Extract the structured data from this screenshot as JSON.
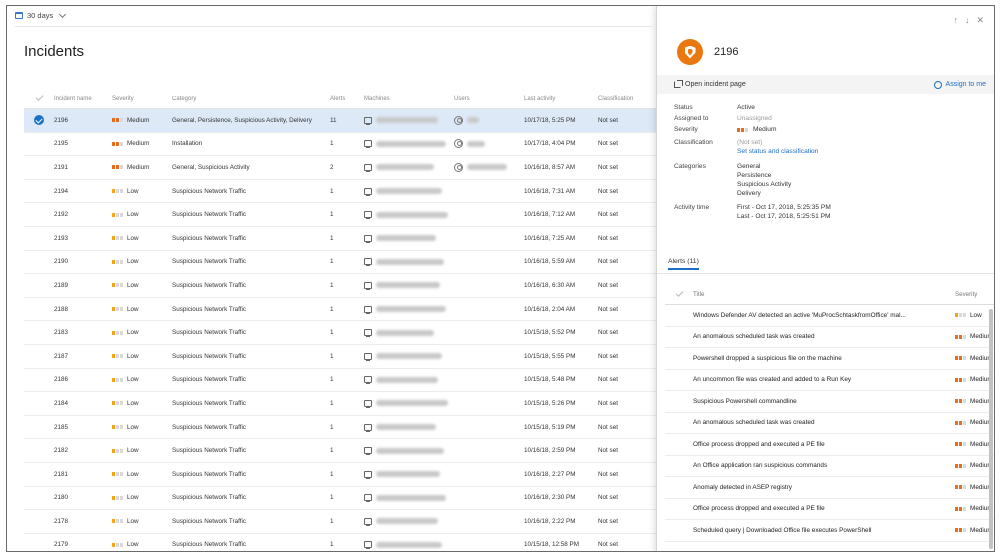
{
  "filter": {
    "label": "30 days"
  },
  "page": {
    "title": "Incidents"
  },
  "table": {
    "headers": [
      "Incident name",
      "Severity",
      "Category",
      "Alerts",
      "Machines",
      "Users",
      "Last activity",
      "Classification"
    ],
    "rows": [
      {
        "id": "2196",
        "severity": "Medium",
        "category": "General, Persistence, Suspicious Activity, Delivery",
        "alerts": "11",
        "users": true,
        "last": "10/17/18, 5:25 PM",
        "class": "Not set",
        "selected": true
      },
      {
        "id": "2195",
        "severity": "Medium",
        "category": "Installation",
        "alerts": "1",
        "users": true,
        "last": "10/17/18, 4:04 PM",
        "class": "Not set"
      },
      {
        "id": "2191",
        "severity": "Medium",
        "category": "General, Suspicious Activity",
        "alerts": "2",
        "users": true,
        "last": "10/16/18, 8:57 AM",
        "class": "Not set"
      },
      {
        "id": "2194",
        "severity": "Low",
        "category": "Suspicious Network Traffic",
        "alerts": "1",
        "last": "10/16/18, 7:31 AM",
        "class": "Not set"
      },
      {
        "id": "2192",
        "severity": "Low",
        "category": "Suspicious Network Traffic",
        "alerts": "1",
        "last": "10/16/18, 7:12 AM",
        "class": "Not set"
      },
      {
        "id": "2193",
        "severity": "Low",
        "category": "Suspicious Network Traffic",
        "alerts": "1",
        "last": "10/16/18, 7:25 AM",
        "class": "Not set"
      },
      {
        "id": "2190",
        "severity": "Low",
        "category": "Suspicious Network Traffic",
        "alerts": "1",
        "last": "10/16/18, 5:59 AM",
        "class": "Not set"
      },
      {
        "id": "2189",
        "severity": "Low",
        "category": "Suspicious Network Traffic",
        "alerts": "1",
        "last": "10/16/18, 6:30 AM",
        "class": "Not set"
      },
      {
        "id": "2188",
        "severity": "Low",
        "category": "Suspicious Network Traffic",
        "alerts": "1",
        "last": "10/16/18, 2:04 AM",
        "class": "Not set"
      },
      {
        "id": "2183",
        "severity": "Low",
        "category": "Suspicious Network Traffic",
        "alerts": "1",
        "last": "10/15/18, 5:52 PM",
        "class": "Not set"
      },
      {
        "id": "2187",
        "severity": "Low",
        "category": "Suspicious Network Traffic",
        "alerts": "1",
        "last": "10/15/18, 5:55 PM",
        "class": "Not set"
      },
      {
        "id": "2186",
        "severity": "Low",
        "category": "Suspicious Network Traffic",
        "alerts": "1",
        "last": "10/15/18, 5:48 PM",
        "class": "Not set"
      },
      {
        "id": "2184",
        "severity": "Low",
        "category": "Suspicious Network Traffic",
        "alerts": "1",
        "last": "10/15/18, 5:26 PM",
        "class": "Not set"
      },
      {
        "id": "2185",
        "severity": "Low",
        "category": "Suspicious Network Traffic",
        "alerts": "1",
        "last": "10/15/18, 5:19 PM",
        "class": "Not set"
      },
      {
        "id": "2182",
        "severity": "Low",
        "category": "Suspicious Network Traffic",
        "alerts": "1",
        "last": "10/16/18, 2:59 PM",
        "class": "Not set"
      },
      {
        "id": "2181",
        "severity": "Low",
        "category": "Suspicious Network Traffic",
        "alerts": "1",
        "last": "10/16/18, 2:27 PM",
        "class": "Not set"
      },
      {
        "id": "2180",
        "severity": "Low",
        "category": "Suspicious Network Traffic",
        "alerts": "1",
        "last": "10/16/18, 2:30 PM",
        "class": "Not set"
      },
      {
        "id": "2178",
        "severity": "Low",
        "category": "Suspicious Network Traffic",
        "alerts": "1",
        "last": "10/16/18, 2:22 PM",
        "class": "Not set"
      },
      {
        "id": "2179",
        "severity": "Low",
        "category": "Suspicious Network Traffic",
        "alerts": "1",
        "last": "10/15/18, 12:58 PM",
        "class": "Not set"
      }
    ]
  },
  "panel": {
    "incident_id": "2196",
    "open_page": "Open incident page",
    "assign": "Assign to me",
    "details": {
      "status_label": "Status",
      "status": "Active",
      "assigned_label": "Assigned to",
      "assigned": "Unassigned",
      "severity_label": "Severity",
      "severity": "Medium",
      "classification_label": "Classification",
      "classification": "(Not set)",
      "classification_link": "Set status and classification",
      "categories_label": "Categories",
      "categories": [
        "General",
        "Persistence",
        "Suspicious Activity",
        "Delivery"
      ],
      "activity_label": "Activity time",
      "first": "First - Oct 17, 2018, 5:25:35 PM",
      "last": "Last - Oct 17, 2018, 5:25:51 PM"
    },
    "alerts_tab": "Alerts (11)",
    "alerts_headers": {
      "title": "Title",
      "severity": "Severity"
    },
    "alerts": [
      {
        "title": "Windows Defender AV detected an active 'MuProcSchtaskfromOffice' mal...",
        "severity": "Low"
      },
      {
        "title": "An anomalous scheduled task was created",
        "severity": "Medium"
      },
      {
        "title": "Powershell dropped a suspicious file on the machine",
        "severity": "Medium"
      },
      {
        "title": "An uncommon file was created and added to a Run Key",
        "severity": "Medium"
      },
      {
        "title": "Suspicious Powershell commandline",
        "severity": "Medium"
      },
      {
        "title": "An anomalous scheduled task was created",
        "severity": "Medium"
      },
      {
        "title": "Office process dropped and executed a PE file",
        "severity": "Medium"
      },
      {
        "title": "An Office application ran suspicious commands",
        "severity": "Medium"
      },
      {
        "title": "Anomaly detected in ASEP registry",
        "severity": "Medium"
      },
      {
        "title": "Office process dropped and executed a PE file",
        "severity": "Medium"
      },
      {
        "title": "Scheduled query | Downloaded Office file executes PowerShell",
        "severity": "Medium"
      }
    ]
  },
  "colors": {
    "accent": "#1a6fc4",
    "medium": "#e86c1e",
    "low": "#f2a51a",
    "selected_row": "#dde9f6"
  }
}
